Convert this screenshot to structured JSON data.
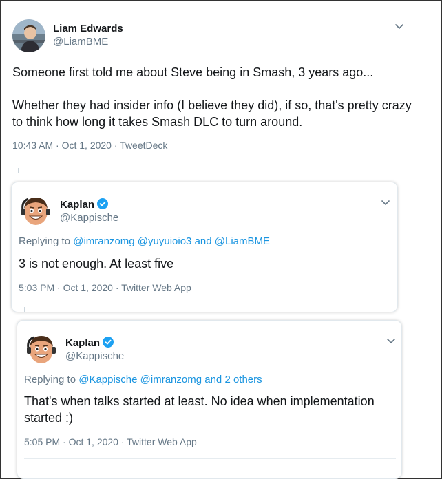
{
  "main_tweet": {
    "author_name": "Liam Edwards",
    "author_handle": "@LiamBME",
    "line1": "Someone first told me about Steve being in Smash, 3 years ago...",
    "line2": "Whether they had insider info (I believe they did), if so, that's pretty crazy to think how long it takes Smash DLC to turn around.",
    "meta": "10:43 AM · Oct 1, 2020 · TweetDeck"
  },
  "reply1": {
    "author_name": "Kaplan",
    "author_handle": "@Kappische",
    "replying_prefix": "Replying to ",
    "replying_links": "@imranzomg @yuyuioio3 and @LiamBME",
    "text": "3 is not enough. At least five",
    "meta": "5:03 PM · Oct 1, 2020 · Twitter Web App"
  },
  "reply2": {
    "author_name": "Kaplan",
    "author_handle": "@Kappische",
    "replying_prefix": "Replying to ",
    "replying_links": "@Kappische @imranzomg and 2 others",
    "text": "That's when talks started at least. No idea when implementation started :)",
    "meta": "5:05 PM · Oct 1, 2020 · Twitter Web App"
  },
  "colors": {
    "link": "#1b95e0",
    "secondary_text": "#657786",
    "verified": "#1da1f2"
  }
}
